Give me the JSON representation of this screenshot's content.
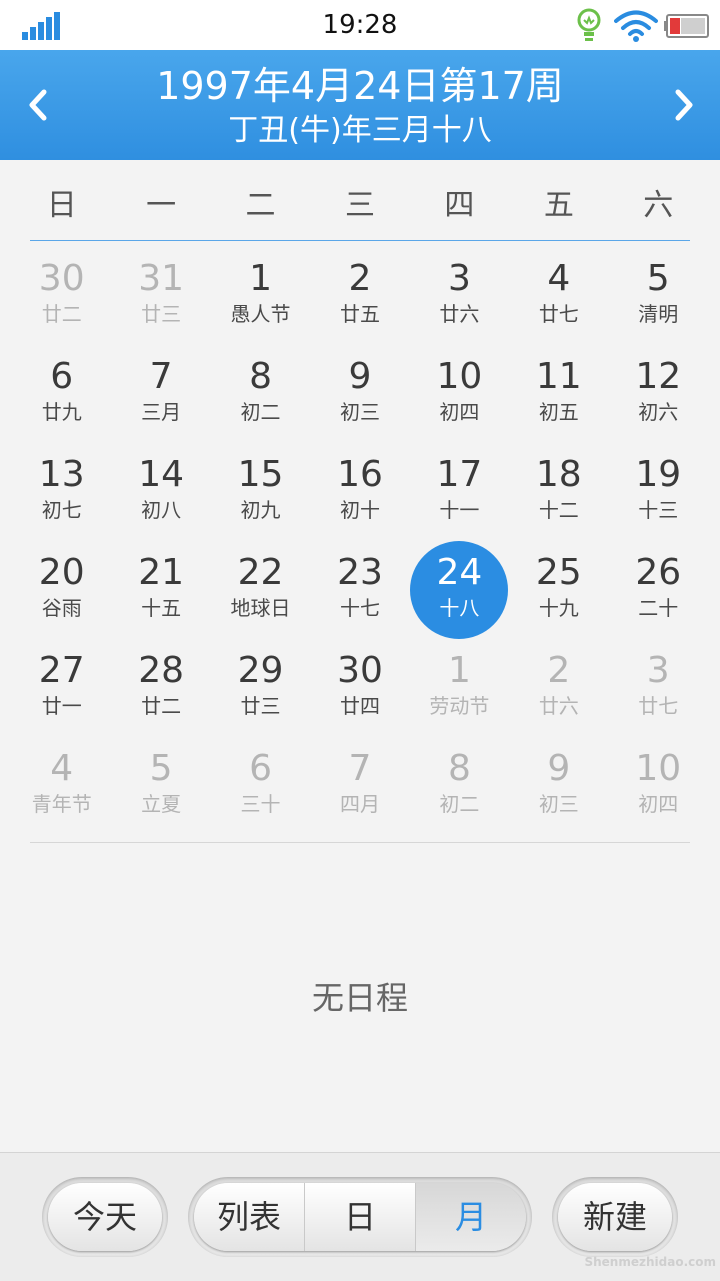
{
  "status_bar": {
    "time": "19:28"
  },
  "header": {
    "title": "1997年4月24日第17周",
    "subtitle": "丁丑(牛)年三月十八"
  },
  "weekdays": [
    "日",
    "一",
    "二",
    "三",
    "四",
    "五",
    "六"
  ],
  "calendar": {
    "weeks": [
      [
        {
          "day": "30",
          "lunar": "廿二",
          "other": true
        },
        {
          "day": "31",
          "lunar": "廿三",
          "other": true
        },
        {
          "day": "1",
          "lunar": "愚人节"
        },
        {
          "day": "2",
          "lunar": "廿五"
        },
        {
          "day": "3",
          "lunar": "廿六"
        },
        {
          "day": "4",
          "lunar": "廿七"
        },
        {
          "day": "5",
          "lunar": "清明"
        }
      ],
      [
        {
          "day": "6",
          "lunar": "廿九"
        },
        {
          "day": "7",
          "lunar": "三月"
        },
        {
          "day": "8",
          "lunar": "初二"
        },
        {
          "day": "9",
          "lunar": "初三"
        },
        {
          "day": "10",
          "lunar": "初四"
        },
        {
          "day": "11",
          "lunar": "初五"
        },
        {
          "day": "12",
          "lunar": "初六"
        }
      ],
      [
        {
          "day": "13",
          "lunar": "初七"
        },
        {
          "day": "14",
          "lunar": "初八"
        },
        {
          "day": "15",
          "lunar": "初九"
        },
        {
          "day": "16",
          "lunar": "初十"
        },
        {
          "day": "17",
          "lunar": "十一"
        },
        {
          "day": "18",
          "lunar": "十二"
        },
        {
          "day": "19",
          "lunar": "十三"
        }
      ],
      [
        {
          "day": "20",
          "lunar": "谷雨"
        },
        {
          "day": "21",
          "lunar": "十五"
        },
        {
          "day": "22",
          "lunar": "地球日"
        },
        {
          "day": "23",
          "lunar": "十七"
        },
        {
          "day": "24",
          "lunar": "十八",
          "selected": true
        },
        {
          "day": "25",
          "lunar": "十九"
        },
        {
          "day": "26",
          "lunar": "二十"
        }
      ],
      [
        {
          "day": "27",
          "lunar": "廿一"
        },
        {
          "day": "28",
          "lunar": "廿二"
        },
        {
          "day": "29",
          "lunar": "廿三"
        },
        {
          "day": "30",
          "lunar": "廿四"
        },
        {
          "day": "1",
          "lunar": "劳动节",
          "other": true
        },
        {
          "day": "2",
          "lunar": "廿六",
          "other": true
        },
        {
          "day": "3",
          "lunar": "廿七",
          "other": true
        }
      ],
      [
        {
          "day": "4",
          "lunar": "青年节",
          "other": true
        },
        {
          "day": "5",
          "lunar": "立夏",
          "other": true
        },
        {
          "day": "6",
          "lunar": "三十",
          "other": true
        },
        {
          "day": "7",
          "lunar": "四月",
          "other": true
        },
        {
          "day": "8",
          "lunar": "初二",
          "other": true
        },
        {
          "day": "9",
          "lunar": "初三",
          "other": true
        },
        {
          "day": "10",
          "lunar": "初四",
          "other": true
        }
      ]
    ]
  },
  "schedule": {
    "empty_message": "无日程"
  },
  "bottom_bar": {
    "today_label": "今天",
    "view_list_label": "列表",
    "view_day_label": "日",
    "view_month_label": "月",
    "new_label": "新建"
  },
  "watermark": "Shenmezhidao.com",
  "colors": {
    "accent": "#2b8de2",
    "header_top": "#49a6ec",
    "header_bottom": "#2f8fe0",
    "muted_text": "#b4b4b4"
  }
}
